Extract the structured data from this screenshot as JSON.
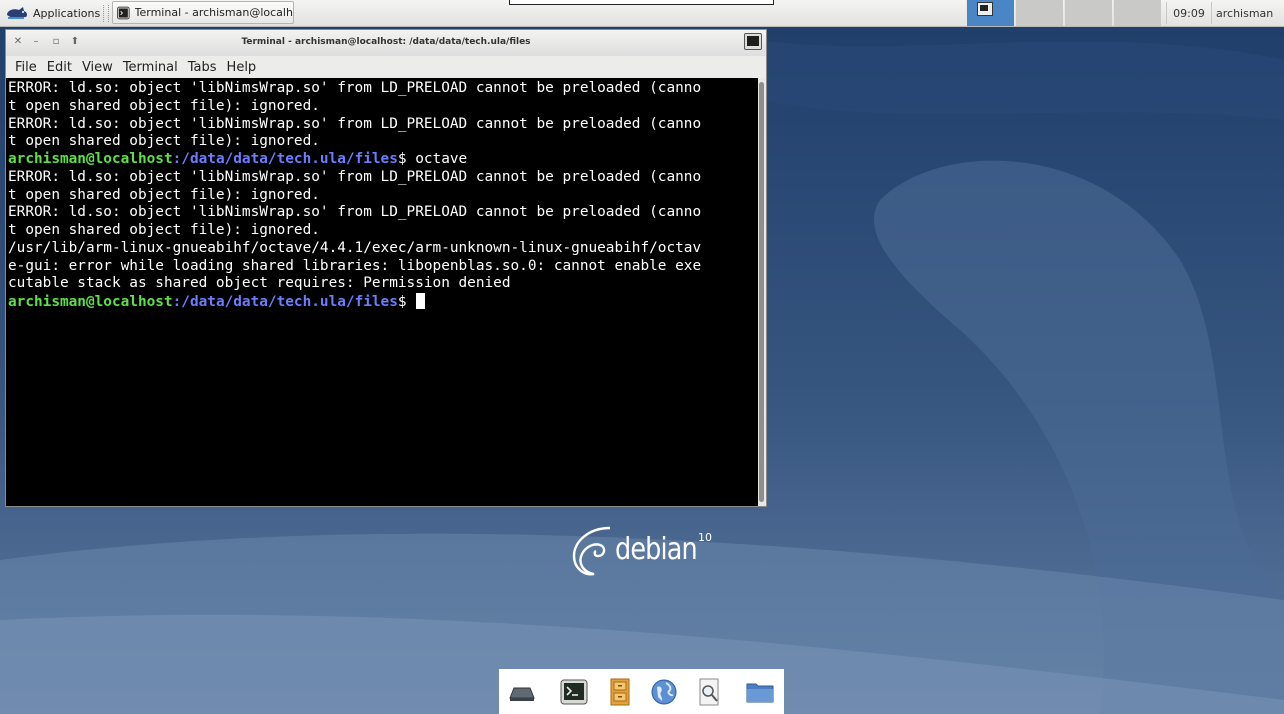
{
  "top_panel": {
    "applications_label": "Applications",
    "task_label": "Terminal - archisman@localho...",
    "clock": "09:09",
    "user": "archisman"
  },
  "terminal": {
    "title": "Terminal - archisman@localhost: /data/data/tech.ula/files",
    "menu": [
      "File",
      "Edit",
      "View",
      "Terminal",
      "Tabs",
      "Help"
    ],
    "lines": [
      "ERROR: ld.so: object 'libNimsWrap.so' from LD_PRELOAD cannot be preloaded (canno",
      "t open shared object file): ignored.",
      "ERROR: ld.so: object 'libNimsWrap.so' from LD_PRELOAD cannot be preloaded (canno",
      "t open shared object file): ignored."
    ],
    "prompt_user": "archisman@localhost",
    "prompt_path": ":/data/data/tech.ula/files",
    "command": "$ octave",
    "lines_after": [
      "ERROR: ld.so: object 'libNimsWrap.so' from LD_PRELOAD cannot be preloaded (canno",
      "t open shared object file): ignored.",
      "ERROR: ld.so: object 'libNimsWrap.so' from LD_PRELOAD cannot be preloaded (canno",
      "t open shared object file): ignored.",
      "/usr/lib/arm-linux-gnueabihf/octave/4.4.1/exec/arm-unknown-linux-gnueabihf/octav",
      "e-gui: error while loading shared libraries: libopenblas.so.0: cannot enable exe",
      "cutable stack as shared object requires: Permission denied"
    ],
    "final_prompt_suffix": "$ "
  },
  "desktop": {
    "logo_word": "debian",
    "logo_version": "10"
  },
  "dock": {
    "items": [
      "show-desktop",
      "terminal",
      "file-cabinet",
      "web-browser",
      "search",
      "folder"
    ]
  },
  "colors": {
    "prompt_user": "#5ee047",
    "prompt_path": "#6a7dff",
    "workspace_active": "#4a86c6"
  }
}
